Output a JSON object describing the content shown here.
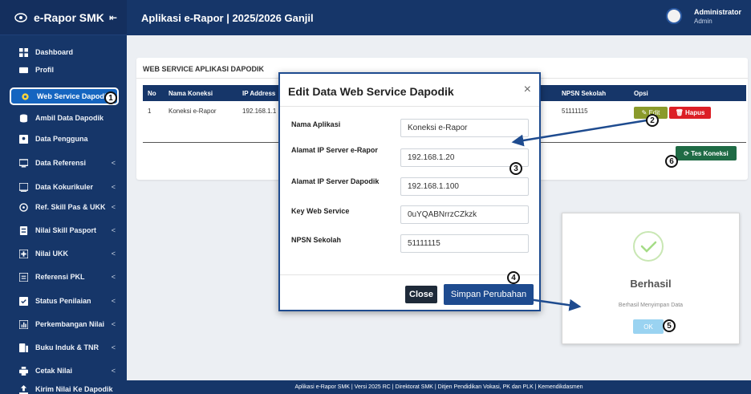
{
  "sidebar": {
    "brand": "e-Rapor SMK",
    "collapse_glyph": "⇤",
    "items": [
      {
        "label": "Dashboard",
        "icon": "dashboard-icon",
        "caret": ""
      },
      {
        "label": "Profil",
        "icon": "id-card-icon",
        "caret": ""
      },
      {
        "label": "Web Service Dapodik",
        "icon": "gear-icon",
        "caret": ""
      },
      {
        "label": "Ambil Data Dapodik",
        "icon": "database-icon",
        "caret": ""
      },
      {
        "label": "Data Pengguna",
        "icon": "user-icon",
        "caret": ""
      },
      {
        "label": "Data Referensi",
        "icon": "monitor-icon",
        "caret": "<"
      },
      {
        "label": "Data Kokurikuler",
        "icon": "tv-icon",
        "caret": "<"
      },
      {
        "label": "Ref. Skill Pas & UKK",
        "icon": "spin-icon",
        "caret": "<"
      },
      {
        "label": "Nilai Skill Pasport",
        "icon": "passport-icon",
        "caret": "<"
      },
      {
        "label": "Nilai UKK",
        "icon": "plus-box-icon",
        "caret": "<"
      },
      {
        "label": "Referensi PKL",
        "icon": "list-icon",
        "caret": "<"
      },
      {
        "label": "Status Penilaian",
        "icon": "check-box-icon",
        "caret": "<"
      },
      {
        "label": "Perkembangan Nilai",
        "icon": "chart-icon",
        "caret": "<"
      },
      {
        "label": "Buku Induk & TNR",
        "icon": "book-icon",
        "caret": "<"
      },
      {
        "label": "Cetak Nilai",
        "icon": "print-icon",
        "caret": "<"
      },
      {
        "label": "Kirim Nilai Ke Dapodik",
        "icon": "upload-icon",
        "caret": ""
      }
    ]
  },
  "header": {
    "title": "Aplikasi e-Rapor | 2025/2026 Ganjil",
    "user_name": "Administrator",
    "user_role": "Admin"
  },
  "card": {
    "title": "WEB SERVICE APLIKASI DAPODIK",
    "columns": [
      "No",
      "Nama Koneksi",
      "IP Address",
      "NPSN Sekolah",
      "Opsi"
    ],
    "row": {
      "no": "1",
      "nama": "Koneksi e-Rapor",
      "ip": "192.168.1.1",
      "npsn": "51111115"
    },
    "edit_label": "Edit",
    "hapus_label": "Hapus",
    "tes_label": "Tes Koneksi"
  },
  "modal": {
    "title": "Edit Data Web Service Dapodik",
    "close_glyph": "×",
    "fields": [
      {
        "label": "Nama Aplikasi",
        "value": "Koneksi e-Rapor"
      },
      {
        "label": "Alamat IP Server e-Rapor",
        "value": "192.168.1.20"
      },
      {
        "label": "Alamat IP Server Dapodik",
        "value": "192.168.1.100"
      },
      {
        "label": "Key Web Service",
        "value": "0uYQABNrrzCZkzk"
      },
      {
        "label": "NPSN Sekolah",
        "value": "51111115"
      }
    ],
    "close_label": "Close",
    "save_label": "Simpan Perubahan"
  },
  "success": {
    "title": "Berhasil",
    "text": "Berhasil Menyimpan Data",
    "ok_label": "OK"
  },
  "footer": {
    "text": "Aplikasi e-Rapor SMK | Versi 2025 RC | Direktorat SMK | Ditjen Pendidikan Vokasi, PK dan PLK | Kemendikdasmen"
  },
  "steps": [
    "1",
    "2",
    "3",
    "4",
    "5",
    "6"
  ],
  "colors": {
    "navy": "#163669",
    "accent": "#1565c0",
    "edit": "#8a9a2b",
    "hapus": "#dc1f26",
    "tes": "#1f6b45"
  }
}
